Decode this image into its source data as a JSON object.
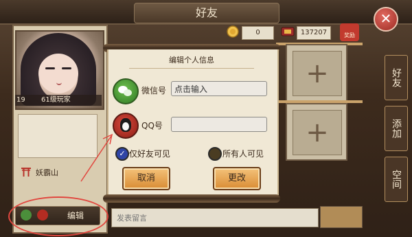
{
  "header": {
    "title": "好友"
  },
  "currency": {
    "coin_value": "0",
    "gold_value": "137207",
    "reward_label": "奖励"
  },
  "profile": {
    "level": "19",
    "level_label": "61级玩家",
    "location": "妖霸山"
  },
  "edit_bar": {
    "label": "编辑"
  },
  "side_tabs": [
    "好友",
    "添加",
    "空间"
  ],
  "message": {
    "placeholder": "发表留言"
  },
  "dialog": {
    "title": "编辑个人信息",
    "wechat_label": "微信号",
    "wechat_value": "点击输入",
    "qq_label": "QQ号",
    "qq_value": "",
    "visibility_friends": "仅好友可见",
    "visibility_all": "所有人可见",
    "cancel_label": "取消",
    "change_label": "更改"
  },
  "colors": {
    "annotation": "#e1473f",
    "wechat": "#4b8f3b",
    "qq": "#b32c22",
    "button": "#e8a652"
  }
}
